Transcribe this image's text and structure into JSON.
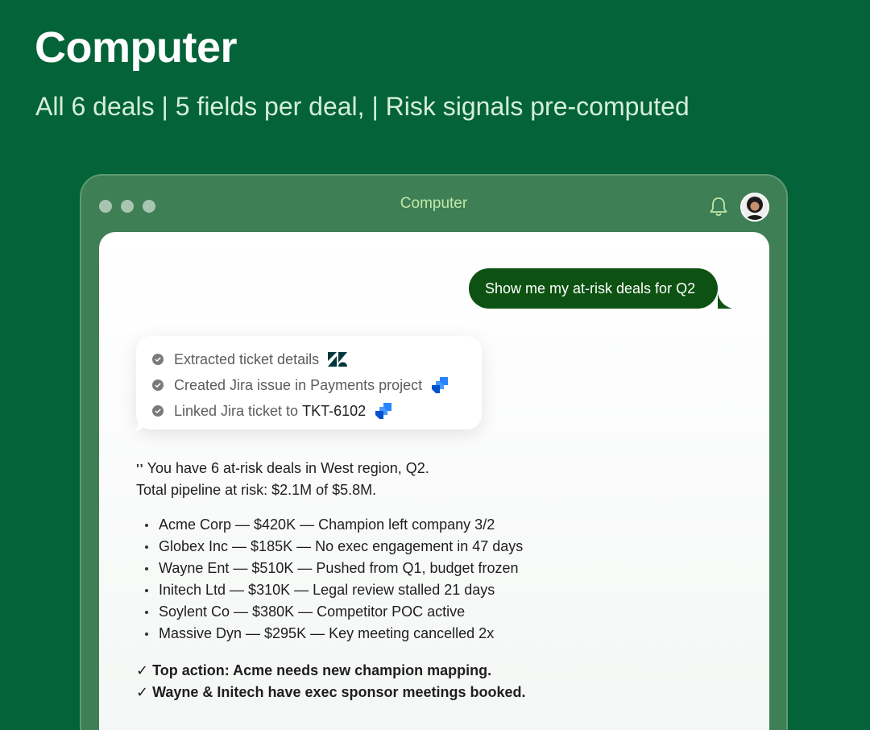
{
  "hero": {
    "title": "Computer",
    "subtitle": "All 6 deals | 5 fields per deal, | Risk signals pre-computed"
  },
  "window": {
    "title": "Computer",
    "icons": [
      "traffic-light-dots",
      "bell-icon",
      "avatar"
    ]
  },
  "chat": {
    "user_message": "Show me my at-risk deals for Q2",
    "tool_steps": [
      {
        "label": "Extracted ticket details",
        "icon": "zendesk-icon"
      },
      {
        "label": "Created Jira issue in Payments project",
        "icon": "jira-icon"
      },
      {
        "label": "Linked Jira ticket to",
        "ticket": "TKT-6102",
        "icon": "jira-icon"
      }
    ],
    "reply": {
      "quote_mark": "''",
      "intro_line1": "You have 6 at-risk deals in West region, Q2.",
      "intro_line2": "Total pipeline at risk: $2.1M of $5.8M.",
      "deals": [
        "Acme Corp — $420K — Champion left company 3/2",
        "Globex Inc — $185K — No exec engagement in 47 days",
        "Wayne Ent — $510K — Pushed from Q1, budget frozen",
        "Initech Ltd — $310K — Legal review stalled 21 days",
        "Soylent Co — $380K — Competitor POC active",
        "Massive Dyn — $295K — Key meeting cancelled 2x"
      ],
      "actions": [
        "✓ Top action: Acme needs new champion mapping.",
        "✓ Wayne & Initech have exec sponsor meetings booked."
      ]
    }
  },
  "colors": {
    "background": "#046338",
    "window": "#3f7f56",
    "user_bubble": "#0d5212",
    "window_title": "#bfe8a8"
  }
}
